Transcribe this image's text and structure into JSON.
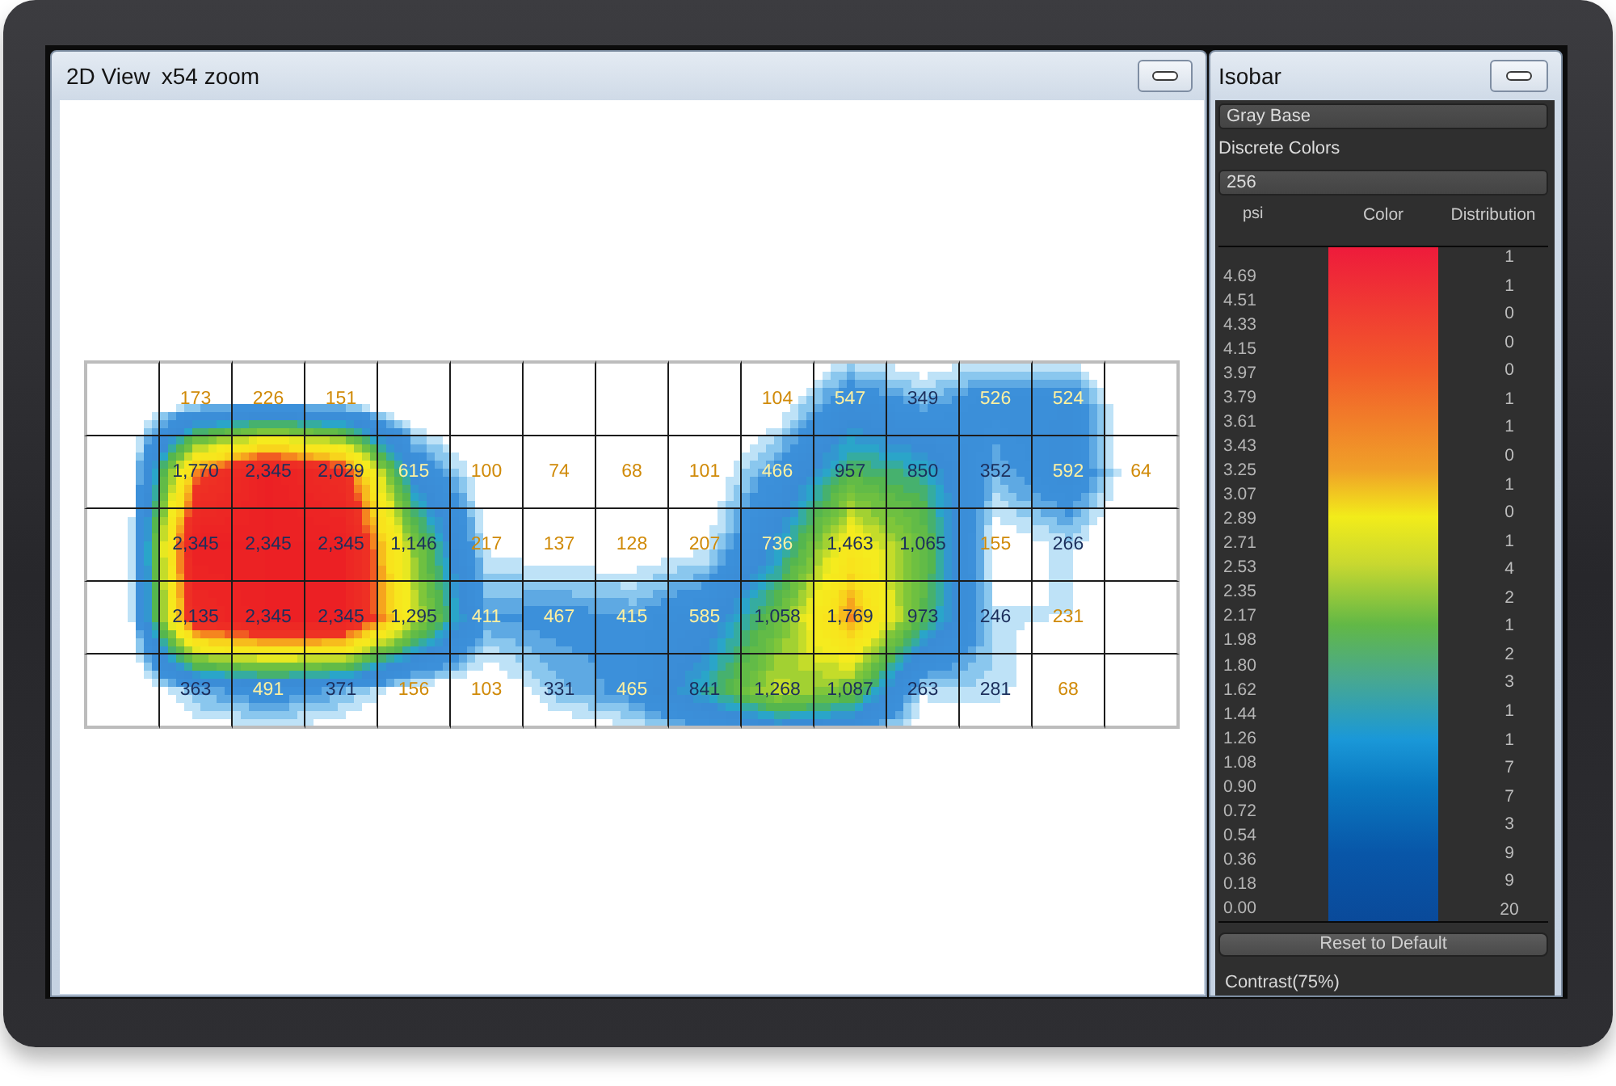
{
  "view_window": {
    "title": "2D View",
    "zoom": "x54 zoom",
    "grid": {
      "rows": [
        [
          null,
          "173",
          "226",
          "151",
          null,
          null,
          null,
          null,
          null,
          "104",
          "547",
          "349",
          "526",
          "524",
          null
        ],
        [
          null,
          "1,770",
          "2,345",
          "2,029",
          "615",
          "100",
          "74",
          "68",
          "101",
          "466",
          "957",
          "850",
          "352",
          "592",
          "64"
        ],
        [
          null,
          "2,345",
          "2,345",
          "2,345",
          "1,146",
          "217",
          "137",
          "128",
          "207",
          "736",
          "1,463",
          "1,065",
          "155",
          "266",
          null
        ],
        [
          null,
          "2,135",
          "2,345",
          "2,345",
          "1,295",
          "411",
          "467",
          "415",
          "585",
          "1,058",
          "1,769",
          "973",
          "246",
          "231",
          null
        ],
        [
          null,
          "363",
          "491",
          "371",
          "156",
          "103",
          "331",
          "465",
          "841",
          "1,268",
          "1,087",
          "263",
          "281",
          "68",
          null
        ]
      ]
    }
  },
  "isobar_panel": {
    "title": "Isobar",
    "base_field": {
      "value": "Gray Base"
    },
    "discrete_colors": {
      "label": "Discrete Colors",
      "value": "256"
    },
    "columns": [
      "psi",
      "Color",
      "Distribution"
    ],
    "psi_labels": [
      "4.69",
      "4.51",
      "4.33",
      "4.15",
      "3.97",
      "3.79",
      "3.61",
      "3.43",
      "3.25",
      "3.07",
      "2.89",
      "2.71",
      "2.53",
      "2.35",
      "2.17",
      "1.98",
      "1.80",
      "1.62",
      "1.44",
      "1.26",
      "1.08",
      "0.90",
      "0.72",
      "0.54",
      "0.36",
      "0.18",
      "0.00"
    ],
    "distribution": [
      "1",
      "1",
      "0",
      "0",
      "0",
      "1",
      "1",
      "0",
      "1",
      "0",
      "1",
      "4",
      "2",
      "1",
      "2",
      "3",
      "1",
      "1",
      "7",
      "7",
      "3",
      "9",
      "9",
      "20"
    ],
    "reset_button": "Reset to Default",
    "contrast_label": "Contrast(75%)"
  }
}
